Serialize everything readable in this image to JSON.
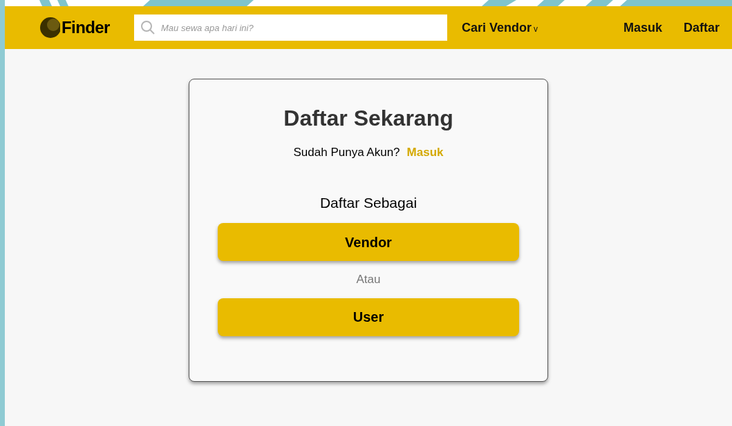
{
  "navbar": {
    "logo": "Finder",
    "search": {
      "placeholder": "Mau sewa apa hari ini?"
    },
    "menu": {
      "label": "Cari Vendor",
      "caret": "v"
    },
    "links": [
      "Masuk",
      "Daftar"
    ]
  },
  "card": {
    "title": "Daftar Sekarang",
    "prompt": "Sudah Punya Akun?",
    "login_link": "Masuk",
    "subtitle": "Daftar Sebagai",
    "options": [
      {
        "kind": "button",
        "label": "Vendor"
      },
      {
        "kind": "separator",
        "label": "Atau"
      },
      {
        "kind": "button",
        "label": "User"
      }
    ]
  }
}
